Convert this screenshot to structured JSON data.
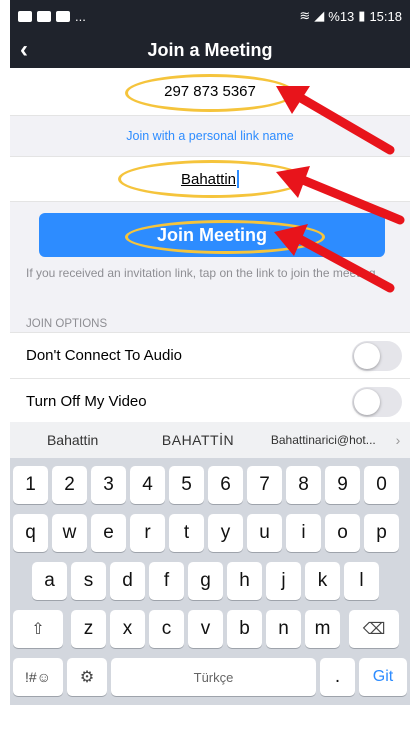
{
  "status_bar": {
    "right_text": "%13",
    "time": "15:18",
    "left_dots": "..."
  },
  "header": {
    "title": "Join a Meeting",
    "back_icon": "chevron-left-icon"
  },
  "meeting_id": {
    "value": "297 873 5367"
  },
  "personal_link": {
    "label": "Join with a personal link name"
  },
  "name_field": {
    "value": "Bahattin"
  },
  "join_button": {
    "label": "Join Meeting"
  },
  "hint": {
    "text": "If you received an invitation link, tap on the link to join the meeting."
  },
  "join_options": {
    "label": "JOIN OPTIONS",
    "items": [
      {
        "label": "Don't Connect To Audio",
        "enabled": false
      },
      {
        "label": "Turn Off My Video",
        "enabled": false
      }
    ]
  },
  "keyboard": {
    "suggestions": [
      "Bahattin",
      "BAHATTİN",
      "Bahattinarici@hot..."
    ],
    "more_icon": "chevron-right-icon",
    "row_numbers": [
      "1",
      "2",
      "3",
      "4",
      "5",
      "6",
      "7",
      "8",
      "9",
      "0"
    ],
    "row_q": [
      "q",
      "w",
      "e",
      "r",
      "t",
      "y",
      "u",
      "i",
      "o",
      "p"
    ],
    "row_a": [
      "a",
      "s",
      "d",
      "f",
      "g",
      "h",
      "j",
      "k",
      "l"
    ],
    "row_z": [
      "z",
      "x",
      "c",
      "v",
      "b",
      "n",
      "m"
    ],
    "shift_icon": "shift-icon",
    "backspace_icon": "backspace-icon",
    "symbols_label": "!#☺",
    "settings_icon": "gear-icon",
    "space_label": "Türkçe",
    "period_label": ".",
    "go_label": "Git"
  },
  "colors": {
    "header_bg": "#1f232c",
    "accent": "#2d8cff",
    "annotation_ellipse": "#f5c43c",
    "annotation_arrow": "#e8141b"
  }
}
